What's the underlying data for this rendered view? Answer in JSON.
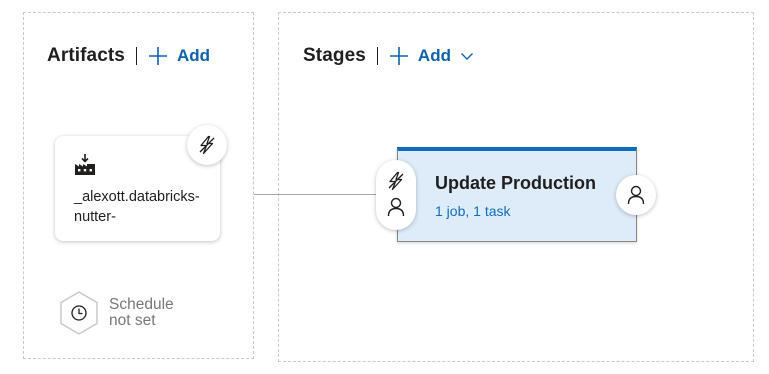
{
  "artifacts": {
    "title": "Artifacts",
    "add_label": "Add",
    "card": {
      "name": "_alexott.databricks-nutter-",
      "icon": "build-artifact-icon",
      "trigger_icon": "lightning-icon"
    },
    "schedule": {
      "icon": "clock-icon",
      "label": "Schedule not set"
    }
  },
  "stages": {
    "title": "Stages",
    "add_label": "Add",
    "items": [
      {
        "name": "Update Production",
        "summary": "1 job, 1 task",
        "pre_deployment_icons": [
          "lightning-icon",
          "person-icon"
        ],
        "post_deployment_icon": "person-icon"
      }
    ]
  },
  "colors": {
    "accent": "#0f6cbd",
    "stage_background": "#deecf9",
    "muted_text": "#797775"
  }
}
